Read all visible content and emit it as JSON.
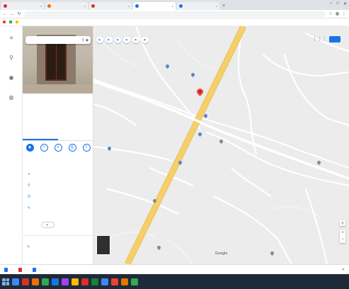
{
  "browser": {
    "tabs": [
      {
        "title": "",
        "color": "#d93025",
        "active": false
      },
      {
        "title": "",
        "color": "#e8710a",
        "active": false
      },
      {
        "title": "",
        "color": "#d93025",
        "active": false
      },
      {
        "title": "",
        "color": "#1a73e8",
        "active": true
      },
      {
        "title": "",
        "color": "#1a73e8",
        "active": false
      }
    ],
    "new_tab": "+",
    "window_controls": [
      "–",
      "□",
      "✕"
    ],
    "url": "",
    "bookmarks": [
      {
        "label": "",
        "color": "#ea4335"
      },
      {
        "label": "",
        "color": "#34a853"
      },
      {
        "label": "",
        "color": "#fbbc04"
      }
    ]
  },
  "rail": {
    "items": [
      {
        "icon": "≡",
        "label": ""
      },
      {
        "icon": "⚲",
        "label": ""
      },
      {
        "icon": "◉",
        "label": ""
      },
      {
        "icon": "◍",
        "label": ""
      }
    ]
  },
  "panel": {
    "search_placeholder": "",
    "title": "",
    "category": "",
    "rating_text": "",
    "stars": "",
    "tabs": [
      "",
      ""
    ],
    "actions": [
      {
        "icon": "◆",
        "label": ""
      },
      {
        "icon": "⚐",
        "label": ""
      },
      {
        "icon": "⌖",
        "label": ""
      },
      {
        "icon": "⎙",
        "label": ""
      },
      {
        "icon": "⇪",
        "label": ""
      }
    ],
    "info_rows": [
      {
        "icon": "⌖",
        "text": ""
      },
      {
        "icon": "⚲",
        "text": ""
      },
      {
        "icon": "⏱",
        "text": ""
      },
      {
        "icon": "✎",
        "text": ""
      }
    ],
    "add_label": "",
    "suggest_heading": "",
    "suggest_row": ""
  },
  "map": {
    "chips": [
      {
        "label": ""
      },
      {
        "label": ""
      },
      {
        "label": ""
      },
      {
        "label": ""
      },
      {
        "label": ""
      },
      {
        "label": ""
      }
    ],
    "sign_in": "",
    "apps_icon": "⋮⋮⋮",
    "labels": [
      "",
      "",
      "",
      "",
      "",
      "",
      "",
      "",
      "",
      ""
    ],
    "thumb_label": "",
    "zoom_in": "+",
    "zoom_out": "−",
    "my_location": "◎",
    "brand": "Google",
    "attribution": ""
  },
  "downloads": {
    "items": [
      {
        "name": "",
        "color": "#1a73e8"
      },
      {
        "name": "",
        "color": "#d93025"
      },
      {
        "name": "",
        "color": "#1a73e8"
      }
    ],
    "show_all": "",
    "close": "✕"
  },
  "taskbar": {
    "icons": [
      "#4285f4",
      "#d93025",
      "#e8710a",
      "#34a853",
      "#1a73e8",
      "#a142f4",
      "#fbbc04",
      "#d93025",
      "#188038",
      "#4285f4",
      "#ea4335",
      "#e37400",
      "#34a853"
    ],
    "clock": ""
  }
}
